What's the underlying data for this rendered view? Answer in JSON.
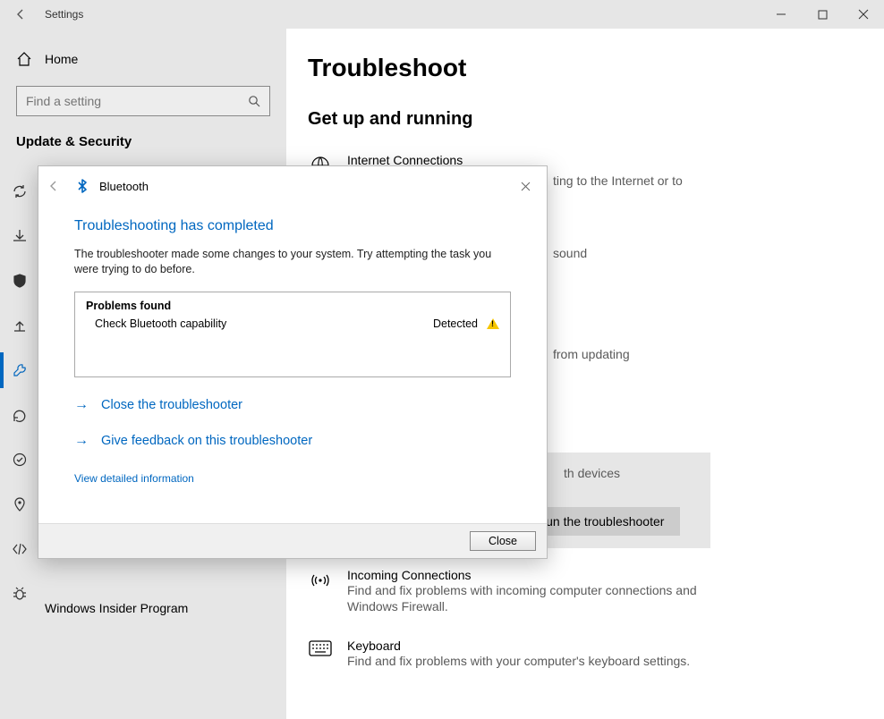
{
  "window": {
    "title": "Settings"
  },
  "sidebar": {
    "home": "Home",
    "search_placeholder": "Find a setting",
    "section": "Update & Security",
    "insider": "Windows Insider Program"
  },
  "page": {
    "heading": "Troubleshoot",
    "subheading": "Get up and running",
    "items": [
      {
        "title": "Internet Connections",
        "desc": "ting to the Internet or to"
      },
      {
        "title": "",
        "desc": "sound"
      },
      {
        "title": "",
        "desc": "from updating"
      }
    ],
    "selected": {
      "desc": "th devices",
      "button": "Run the troubleshooter"
    },
    "below": [
      {
        "title": "Incoming Connections",
        "desc": "Find and fix problems with incoming computer connections and Windows Firewall."
      },
      {
        "title": "Keyboard",
        "desc": "Find and fix problems with your computer's keyboard settings."
      }
    ]
  },
  "dialog": {
    "module": "Bluetooth",
    "heading": "Troubleshooting has completed",
    "paragraph": "The troubleshooter made some changes to your system. Try attempting the task you were trying to do before.",
    "problems_header": "Problems found",
    "problem": "Check Bluetooth capability",
    "status": "Detected",
    "close_ts": "Close the troubleshooter",
    "feedback": "Give feedback on this troubleshooter",
    "detailed": "View detailed information",
    "close_btn": "Close"
  }
}
